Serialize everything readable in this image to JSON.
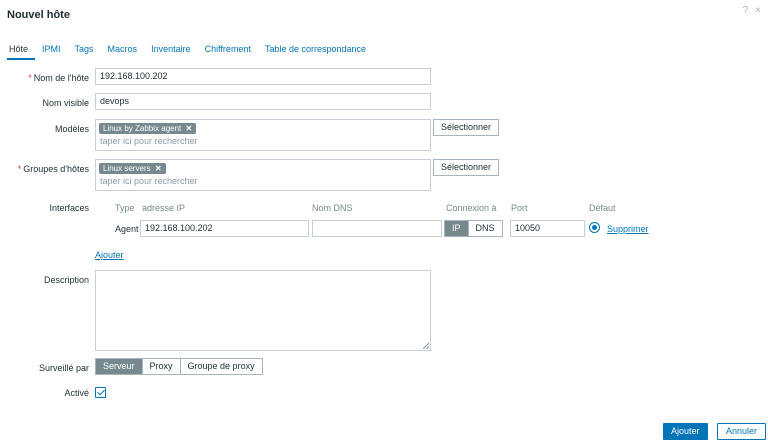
{
  "dialog": {
    "title": "Nouvel hôte",
    "help_glyph": "?",
    "close_glyph": "×"
  },
  "tabs": [
    {
      "label": "Hôte",
      "active": true
    },
    {
      "label": "IPMI"
    },
    {
      "label": "Tags"
    },
    {
      "label": "Macros"
    },
    {
      "label": "Inventaire"
    },
    {
      "label": "Chiffrement"
    },
    {
      "label": "Table de correspondance"
    }
  ],
  "form": {
    "required_mark": "*",
    "host_name": {
      "label": "Nom de l'hôte",
      "value": "192.168.100.202"
    },
    "visible_name": {
      "label": "Nom visible",
      "value": "devops"
    },
    "templates": {
      "label": "Modèles",
      "tag": "Linux by Zabbix agent",
      "remove_glyph": "✕",
      "placeholder": "taper ici pour rechercher",
      "select_button": "Sélectionner"
    },
    "host_groups": {
      "label": "Groupes d'hôtes",
      "tag": "Linux servers",
      "remove_glyph": "✕",
      "placeholder": "taper ici pour rechercher",
      "select_button": "Sélectionner"
    },
    "interfaces": {
      "label": "Interfaces",
      "headers": {
        "type": "Type",
        "ip": "adresse IP",
        "dns": "Nom DNS",
        "connect": "Connexion à",
        "port": "Port",
        "default": "Défaut"
      },
      "row": {
        "type": "Agent",
        "ip": "192.168.100.202",
        "dns": "",
        "connect_ip": "IP",
        "connect_dns": "DNS",
        "port": "10050",
        "remove": "Supprimer"
      },
      "add": "Ajouter"
    },
    "description": {
      "label": "Description",
      "value": ""
    },
    "monitored_by": {
      "label": "Surveillé par",
      "options": [
        "Serveur",
        "Proxy",
        "Groupe de proxy"
      ],
      "selected": "Serveur"
    },
    "enabled": {
      "label": "Activé",
      "checked": true
    }
  },
  "footer": {
    "add_button": "Ajouter",
    "cancel_button": "Annuler"
  },
  "colors": {
    "accent": "#0275b8",
    "tag_bg": "#76898f",
    "required": "#e33734"
  }
}
